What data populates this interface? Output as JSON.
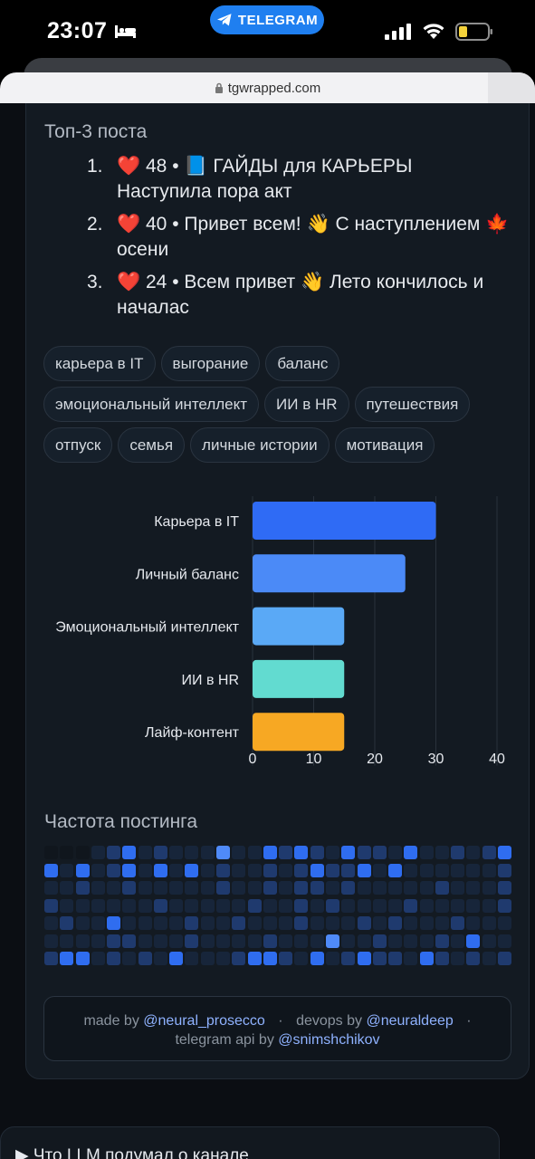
{
  "status_bar": {
    "time": "23:07",
    "app_pill": "TELEGRAM"
  },
  "browser": {
    "url": "tgwrapped.com"
  },
  "top_posts": {
    "title": "Топ-3 поста",
    "items": [
      {
        "num": "1.",
        "heart": "❤️",
        "likes": "48",
        "sep": "•",
        "text": "📘 ГАЙДЫ для КАРЬЕРЫ Наступила пора акт"
      },
      {
        "num": "2.",
        "heart": "❤️",
        "likes": "40",
        "sep": "•",
        "text": "Привет всем! 👋 С наступлением 🍁 осени"
      },
      {
        "num": "3.",
        "heart": "❤️",
        "likes": "24",
        "sep": "•",
        "text": "Всем привет 👋 Лето кончилось и началас"
      }
    ]
  },
  "tags": [
    "карьера в IT",
    "выгорание",
    "баланс",
    "эмоциональный интеллект",
    "ИИ в HR",
    "путешествия",
    "отпуск",
    "семья",
    "личные истории",
    "мотивация"
  ],
  "chart_data": {
    "type": "bar",
    "orientation": "horizontal",
    "categories": [
      "Карьера в IT",
      "Личный баланс",
      "Эмоциональный интеллект",
      "ИИ в HR",
      "Лайф-контент"
    ],
    "values": [
      30,
      25,
      15,
      15,
      15
    ],
    "colors": [
      "#2f6bf5",
      "#4b8af7",
      "#5aa9f6",
      "#62dbd0",
      "#f7a823"
    ],
    "xlim": [
      0,
      40
    ],
    "xticks": [
      "0",
      "10",
      "20",
      "30",
      "40"
    ],
    "grid": true
  },
  "heatmap": {
    "title": "Частота постинга",
    "rows": [
      [
        0,
        0,
        0,
        1,
        2,
        3,
        1,
        2,
        1,
        1,
        1,
        4,
        1,
        1,
        3,
        2,
        3,
        2,
        1,
        3,
        2,
        2,
        1,
        3,
        1,
        1,
        2,
        1,
        2,
        3
      ],
      [
        3,
        1,
        3,
        1,
        2,
        3,
        1,
        3,
        1,
        3,
        1,
        2,
        1,
        1,
        2,
        1,
        2,
        3,
        2,
        2,
        3,
        1,
        3,
        1,
        1,
        1,
        1,
        1,
        1,
        2
      ],
      [
        1,
        1,
        2,
        1,
        1,
        2,
        1,
        1,
        1,
        1,
        1,
        2,
        1,
        1,
        2,
        1,
        2,
        2,
        1,
        2,
        1,
        1,
        1,
        1,
        1,
        2,
        1,
        1,
        1,
        2
      ],
      [
        2,
        1,
        1,
        1,
        1,
        1,
        1,
        2,
        1,
        1,
        1,
        1,
        1,
        2,
        1,
        1,
        2,
        1,
        2,
        1,
        1,
        1,
        1,
        2,
        1,
        1,
        1,
        1,
        1,
        2
      ],
      [
        1,
        2,
        1,
        1,
        3,
        1,
        1,
        1,
        1,
        2,
        1,
        1,
        2,
        1,
        1,
        1,
        2,
        1,
        1,
        1,
        2,
        1,
        2,
        1,
        1,
        1,
        2,
        1,
        1,
        1
      ],
      [
        1,
        1,
        1,
        1,
        2,
        2,
        1,
        1,
        1,
        2,
        1,
        1,
        1,
        1,
        2,
        1,
        1,
        1,
        4,
        1,
        1,
        2,
        1,
        1,
        1,
        2,
        1,
        3,
        1,
        1
      ],
      [
        2,
        3,
        3,
        1,
        2,
        1,
        2,
        1,
        3,
        1,
        1,
        1,
        2,
        3,
        3,
        2,
        1,
        3,
        1,
        2,
        3,
        2,
        2,
        1,
        3,
        2,
        1,
        2,
        1,
        2
      ]
    ],
    "colors": [
      "#10161d",
      "#17253a",
      "#1f3a6e",
      "#2f6df0",
      "#4f8af8"
    ]
  },
  "footer": {
    "made_by_label": "made by",
    "made_by_handle": "@neural_prosecco",
    "devops_label": "devops by",
    "devops_handle": "@neuraldeep",
    "separator": "·",
    "api_label": "telegram api by",
    "api_handle": "@snimshchikov"
  },
  "summary": {
    "label": "▶ Что LLM подумал о канале"
  }
}
